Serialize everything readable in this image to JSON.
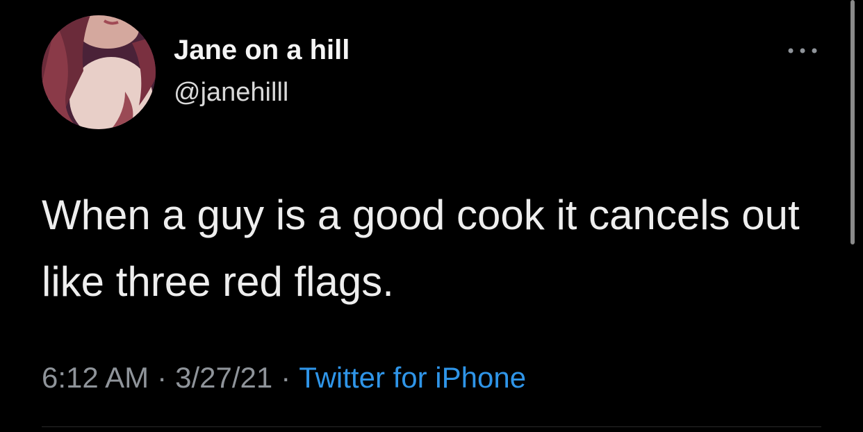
{
  "user": {
    "display_name": "Jane on a hill",
    "handle": "@janehilll",
    "avatar_icon": "profile-photo"
  },
  "tweet": {
    "text": "When a guy is a good cook it cancels out like three red flags.",
    "time": "6:12 AM",
    "separator": "·",
    "date": "3/27/21",
    "source": "Twitter for iPhone"
  },
  "actions": {
    "more_icon": "more-dots-icon"
  },
  "colors": {
    "background": "#000000",
    "link": "#2f95e8",
    "meta": "#8f949a"
  }
}
